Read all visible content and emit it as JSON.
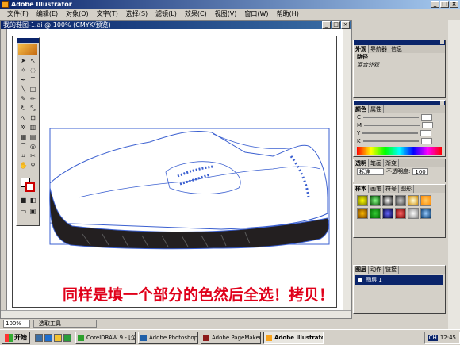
{
  "app": {
    "title": "Adobe Illustrator"
  },
  "menu": [
    "文件(F)",
    "编辑(E)",
    "对象(O)",
    "文字(T)",
    "选择(S)",
    "滤镜(L)",
    "效果(C)",
    "视图(V)",
    "窗口(W)",
    "帮助(H)"
  ],
  "document": {
    "title": "我的鞋图-1.ai @ 100% (CMYK/预览)"
  },
  "caption": "同样是填一个部分的色然后全选！拷贝！",
  "status": {
    "zoom": "100%",
    "tool": "选取工具"
  },
  "panels": {
    "appearance": {
      "tabs": [
        "外观",
        "导航器",
        "信息"
      ],
      "rows": [
        "路径",
        "混合外观"
      ]
    },
    "color": {
      "tabs": [
        "颜色",
        "属性"
      ],
      "channels": [
        "C",
        "M",
        "Y",
        "K"
      ]
    },
    "transparency": {
      "tabs": [
        "透明",
        "笔画",
        "渐变"
      ],
      "mode": "标准",
      "opacity_label": "不透明度:",
      "opacity": "100"
    },
    "swatches": {
      "tabs": [
        "样本",
        "画笔",
        "符号",
        "图形"
      ]
    },
    "layers": {
      "tabs": [
        "图层",
        "动作",
        "链接"
      ],
      "layer_name": "图层 1"
    }
  },
  "taskbar": {
    "start": "开始",
    "tasks": [
      "CorelDRAW 9 - [企业...",
      "Adobe Photoshop",
      "Adobe PageMaker 6.5...",
      "Adobe Illustrator"
    ],
    "ime": "CH",
    "clock": "12:45"
  },
  "colors": {
    "title_bar": "#0a246a",
    "path_stroke": "#3a5fd0",
    "fill": "#231f20",
    "caption": "#e0001a"
  },
  "icons": [
    "selection-arrow-icon",
    "direct-select-icon",
    "pen-icon",
    "type-icon",
    "brush-icon",
    "rotate-icon",
    "scale-icon",
    "blend-icon",
    "gradient-icon",
    "eyedropper-icon",
    "zoom-icon",
    "hand-icon"
  ]
}
